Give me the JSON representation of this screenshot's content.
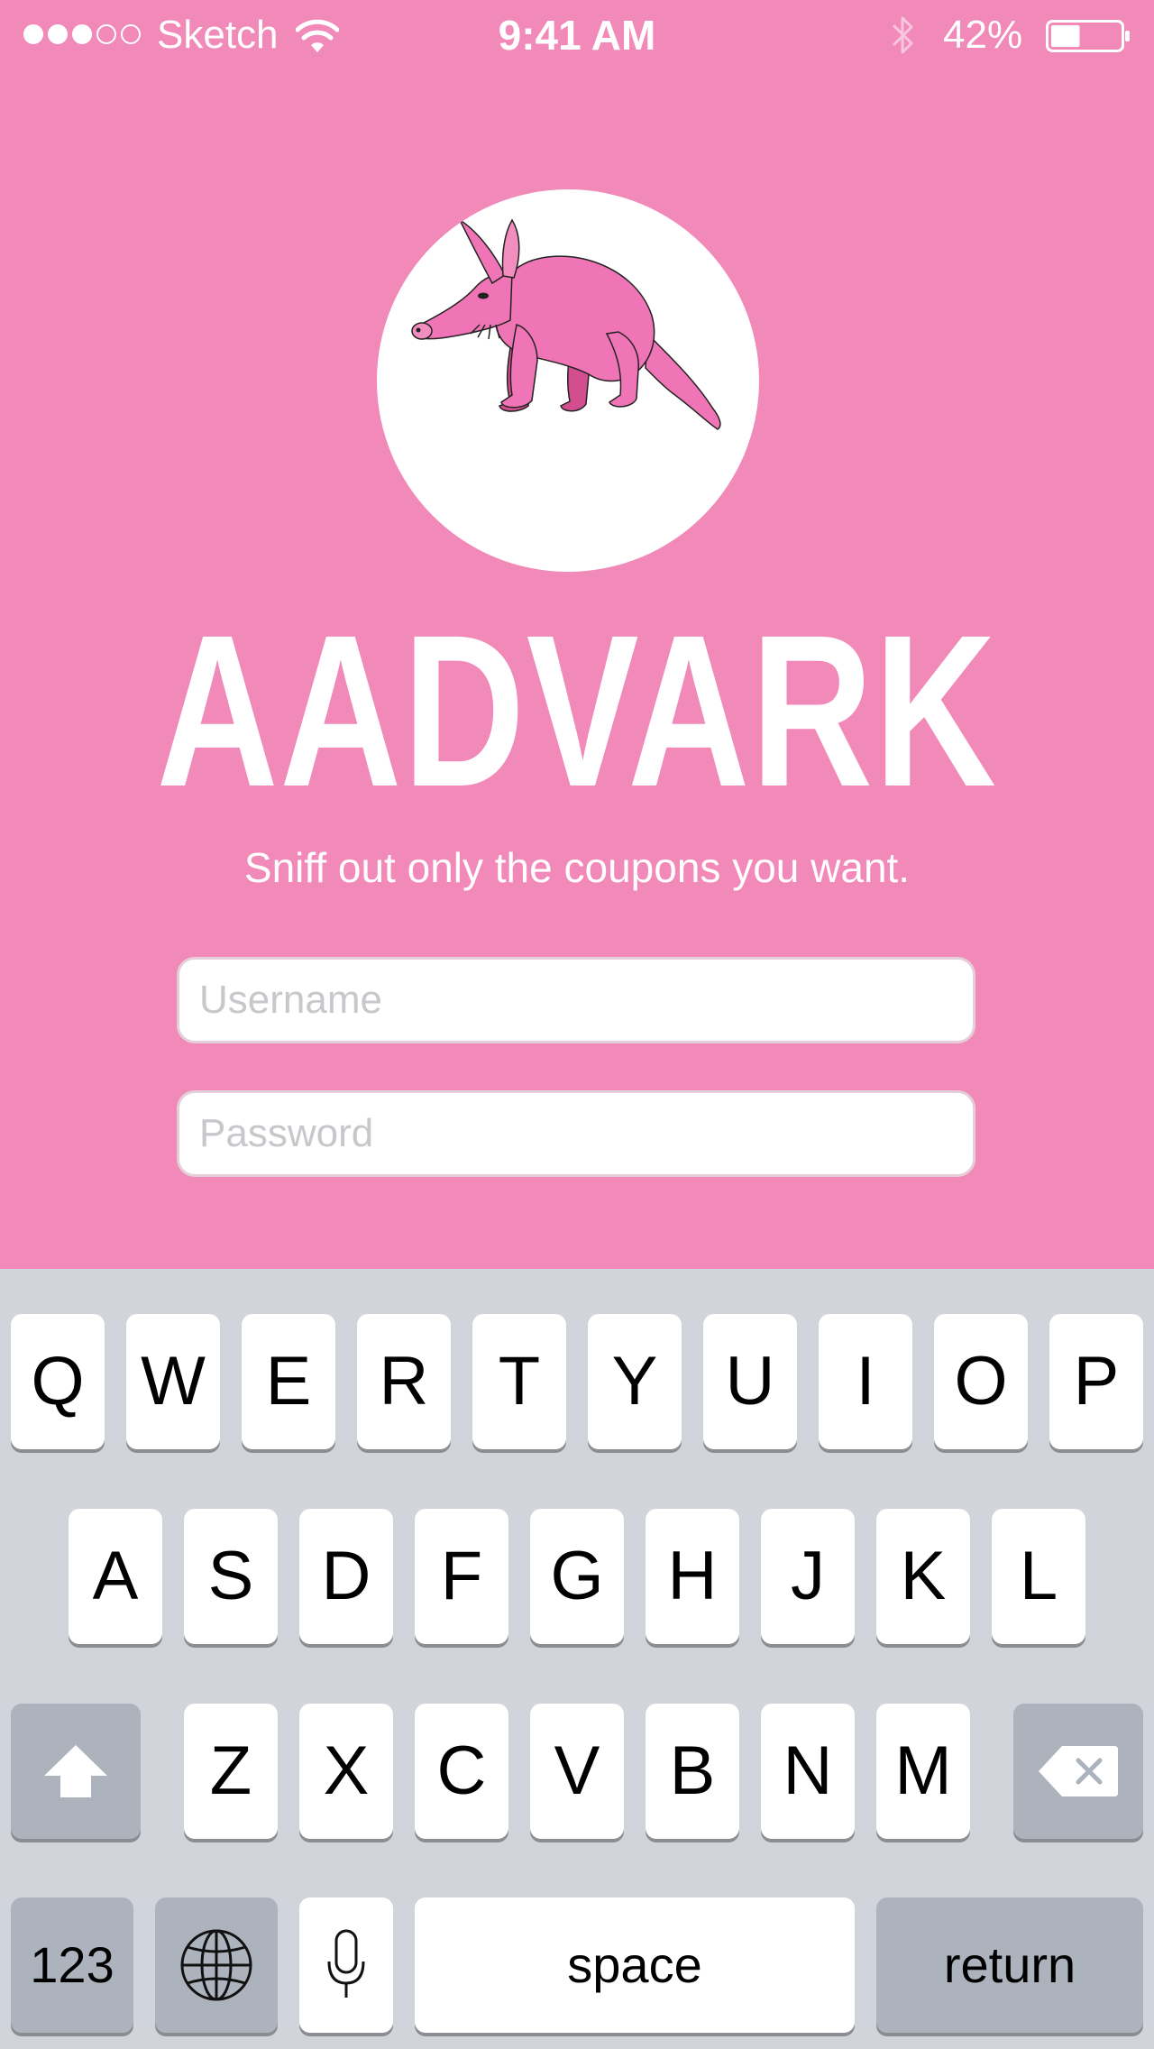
{
  "status_bar": {
    "signal_dots": [
      true,
      true,
      true,
      false,
      false
    ],
    "carrier": "Sketch",
    "time": "9:41 AM",
    "battery_percent": "42%",
    "battery_level": 0.42,
    "icons": [
      "wifi-icon",
      "bluetooth-icon",
      "battery-icon"
    ]
  },
  "app": {
    "logo_icon": "aardvark-illustration",
    "name": "AADVARK",
    "tagline": "Sniff out only the coupons you want."
  },
  "form": {
    "username_placeholder": "Username",
    "password_placeholder": "Password"
  },
  "keyboard": {
    "row1": [
      "Q",
      "W",
      "E",
      "R",
      "T",
      "Y",
      "U",
      "I",
      "O",
      "P"
    ],
    "row2": [
      "A",
      "S",
      "D",
      "F",
      "G",
      "H",
      "J",
      "K",
      "L"
    ],
    "row3": [
      "Z",
      "X",
      "C",
      "V",
      "B",
      "N",
      "M"
    ],
    "shift_icon": "shift-arrow-icon",
    "backspace_icon": "backspace-icon",
    "numbers_label": "123",
    "globe_icon": "globe-icon",
    "mic_icon": "microphone-icon",
    "space_label": "space",
    "return_label": "return"
  },
  "colors": {
    "background": "#f189b9",
    "keyboard": "#d1d5db",
    "function_key": "#adb3bd",
    "aardvark_body": "#f075b6",
    "aardvark_legs": "#d34e8e"
  }
}
